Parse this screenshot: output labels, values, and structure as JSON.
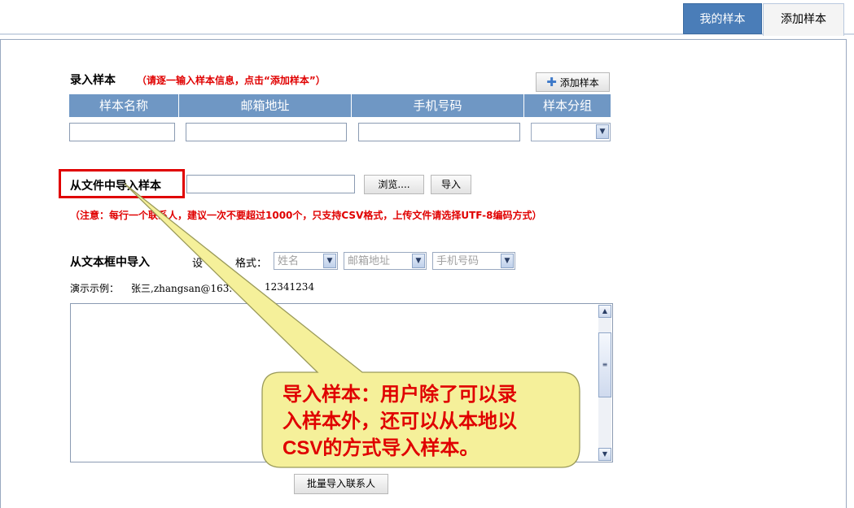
{
  "tabs": {
    "my_samples": "我的样本",
    "add_sample": "添加样本"
  },
  "entry": {
    "title": "录入样本",
    "hint": "（请逐一输入样本信息，点击“添加样本”）",
    "add_button": "添加样本",
    "columns": [
      "样本名称",
      "邮箱地址",
      "手机号码",
      "样本分组"
    ]
  },
  "file_import": {
    "title": "从文件中导入样本",
    "browse_button": "浏览....",
    "import_button": "导入",
    "note": "（注意：每行一个联系人，建议一次不要超过1000个，只支持CSV格式，上传文件请选择UTF-8编码方式）"
  },
  "text_import": {
    "title": "从文本框中导入",
    "format_label_left": "设",
    "format_label_right": "格式：",
    "format_options": [
      "姓名",
      "邮箱地址",
      "手机号码"
    ],
    "example_label": "演示示例：",
    "example_name": "张三,zhangsan@163.",
    "example_phone": "12341234",
    "batch_button": "批量导入联系人"
  },
  "callout": {
    "line1": "导入样本：用户除了可以录",
    "line2": "入样本外，还可以从本地以",
    "line3_strong": "CSV",
    "line3_rest": "的方式导入样本。"
  },
  "colors": {
    "accent": "#6f97c4",
    "highlight_border": "#e00000",
    "callout_fill": "#f5f09a"
  }
}
